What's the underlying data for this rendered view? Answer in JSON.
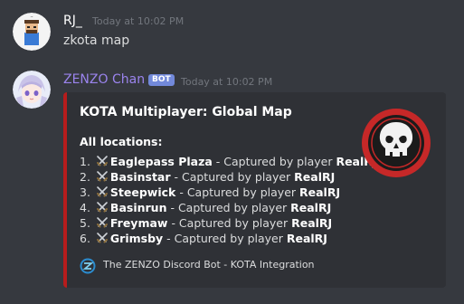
{
  "messages": [
    {
      "username": "RJ_",
      "username_color": "#ffffff",
      "timestamp": "Today at 10:02 PM",
      "content": "zkota map"
    },
    {
      "username": "ZENZO Chan",
      "username_color": "#9b84ee",
      "bot_badge": "BOT",
      "timestamp": "Today at 10:02 PM",
      "embed": {
        "accent_color": "#b71c1c",
        "title": "KOTA Multiplayer: Global Map",
        "field_name": "All locations:",
        "locations": [
          {
            "index": "1.",
            "name": "Eaglepass Plaza",
            "middle": " - Captured by player ",
            "player": "RealRJ"
          },
          {
            "index": "2.",
            "name": "Basinstar",
            "middle": " - Captured by player ",
            "player": "RealRJ"
          },
          {
            "index": "3.",
            "name": "Steepwick",
            "middle": " - Captured by player ",
            "player": "RealRJ"
          },
          {
            "index": "4.",
            "name": "Basinrun",
            "middle": " - Captured by player ",
            "player": "RealRJ"
          },
          {
            "index": "5.",
            "name": "Freymaw",
            "middle": " - Captured by player ",
            "player": "RealRJ"
          },
          {
            "index": "6.",
            "name": "Grimsby",
            "middle": " - Captured by player ",
            "player": "RealRJ"
          }
        ],
        "location_icon": "crossed-swords-icon",
        "thumbnail_icon": "skull-icon",
        "footer_text": "The ZENZO Discord Bot - KOTA Integration",
        "footer_icon": "zenzo-logo-icon"
      }
    }
  ]
}
